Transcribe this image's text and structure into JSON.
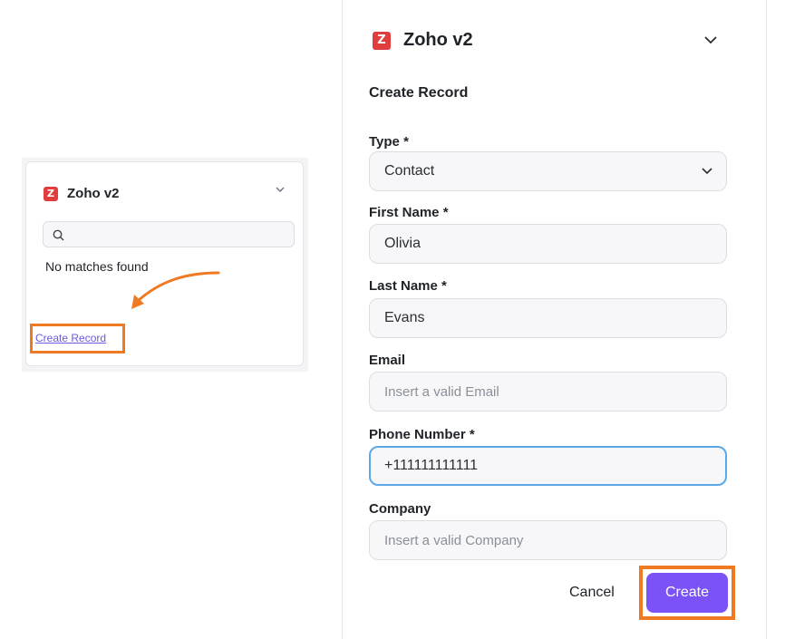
{
  "left_card": {
    "title": "Zoho v2",
    "logo_letter": "Z",
    "search_placeholder": "",
    "no_matches": "No matches found",
    "create_link": "Create Record"
  },
  "form": {
    "title": "Zoho v2",
    "logo_letter": "Z",
    "section_title": "Create Record",
    "fields": {
      "type": {
        "label": "Type *",
        "value": "Contact"
      },
      "first_name": {
        "label": "First Name *",
        "value": "Olivia"
      },
      "last_name": {
        "label": "Last Name *",
        "value": "Evans"
      },
      "email": {
        "label": "Email",
        "placeholder": "Insert a valid Email"
      },
      "phone": {
        "label": "Phone Number *",
        "value": "+111111111111"
      },
      "company": {
        "label": "Company",
        "placeholder": "Insert a valid Company"
      }
    },
    "cancel_label": "Cancel",
    "create_label": "Create"
  },
  "colors": {
    "accent": "#7b52f5",
    "highlight": "#f07a22",
    "logo": "#e03e3e",
    "focus": "#5aa9e6"
  }
}
